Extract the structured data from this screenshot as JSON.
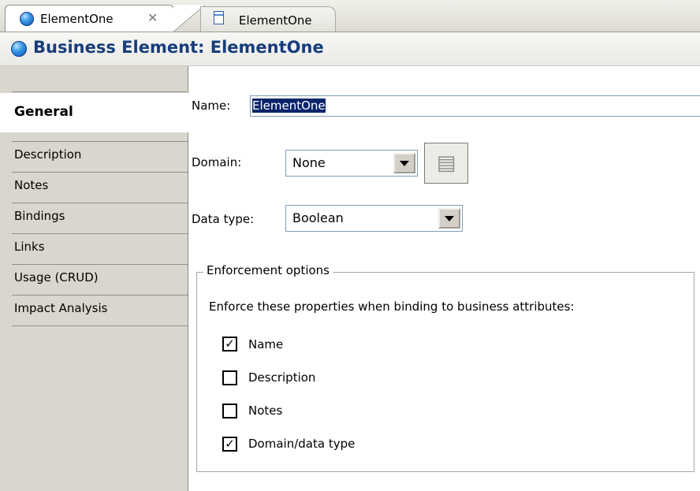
{
  "tabs": [
    {
      "label": "ElementOne",
      "icon": "globe-icon",
      "closable": true
    },
    {
      "label": "ElementOne",
      "icon": "document-icon"
    }
  ],
  "header": {
    "title": "Business Element: ElementOne",
    "icon": "globe-icon"
  },
  "sidebar": {
    "items": [
      {
        "label": "General",
        "active": true
      },
      {
        "label": "Description"
      },
      {
        "label": "Notes"
      },
      {
        "label": "Bindings"
      },
      {
        "label": "Links"
      },
      {
        "label": "Usage (CRUD)"
      },
      {
        "label": "Impact Analysis"
      }
    ]
  },
  "form": {
    "name_label": "Name:",
    "name_value": "ElementOne",
    "domain_label": "Domain:",
    "domain_value": "None",
    "datatype_label": "Data type:",
    "datatype_value": "Boolean"
  },
  "enforcement": {
    "group_title": "Enforcement options",
    "instruction": "Enforce these properties when binding to business attributes:",
    "options": [
      {
        "label": "Name",
        "checked": true
      },
      {
        "label": "Description",
        "checked": false
      },
      {
        "label": "Notes",
        "checked": false
      },
      {
        "label": "Domain/data type",
        "checked": true
      }
    ]
  },
  "colors": {
    "header_text": "#173d7a",
    "sidebar_bg": "#d9d7cd",
    "selection": "#0a246a"
  }
}
